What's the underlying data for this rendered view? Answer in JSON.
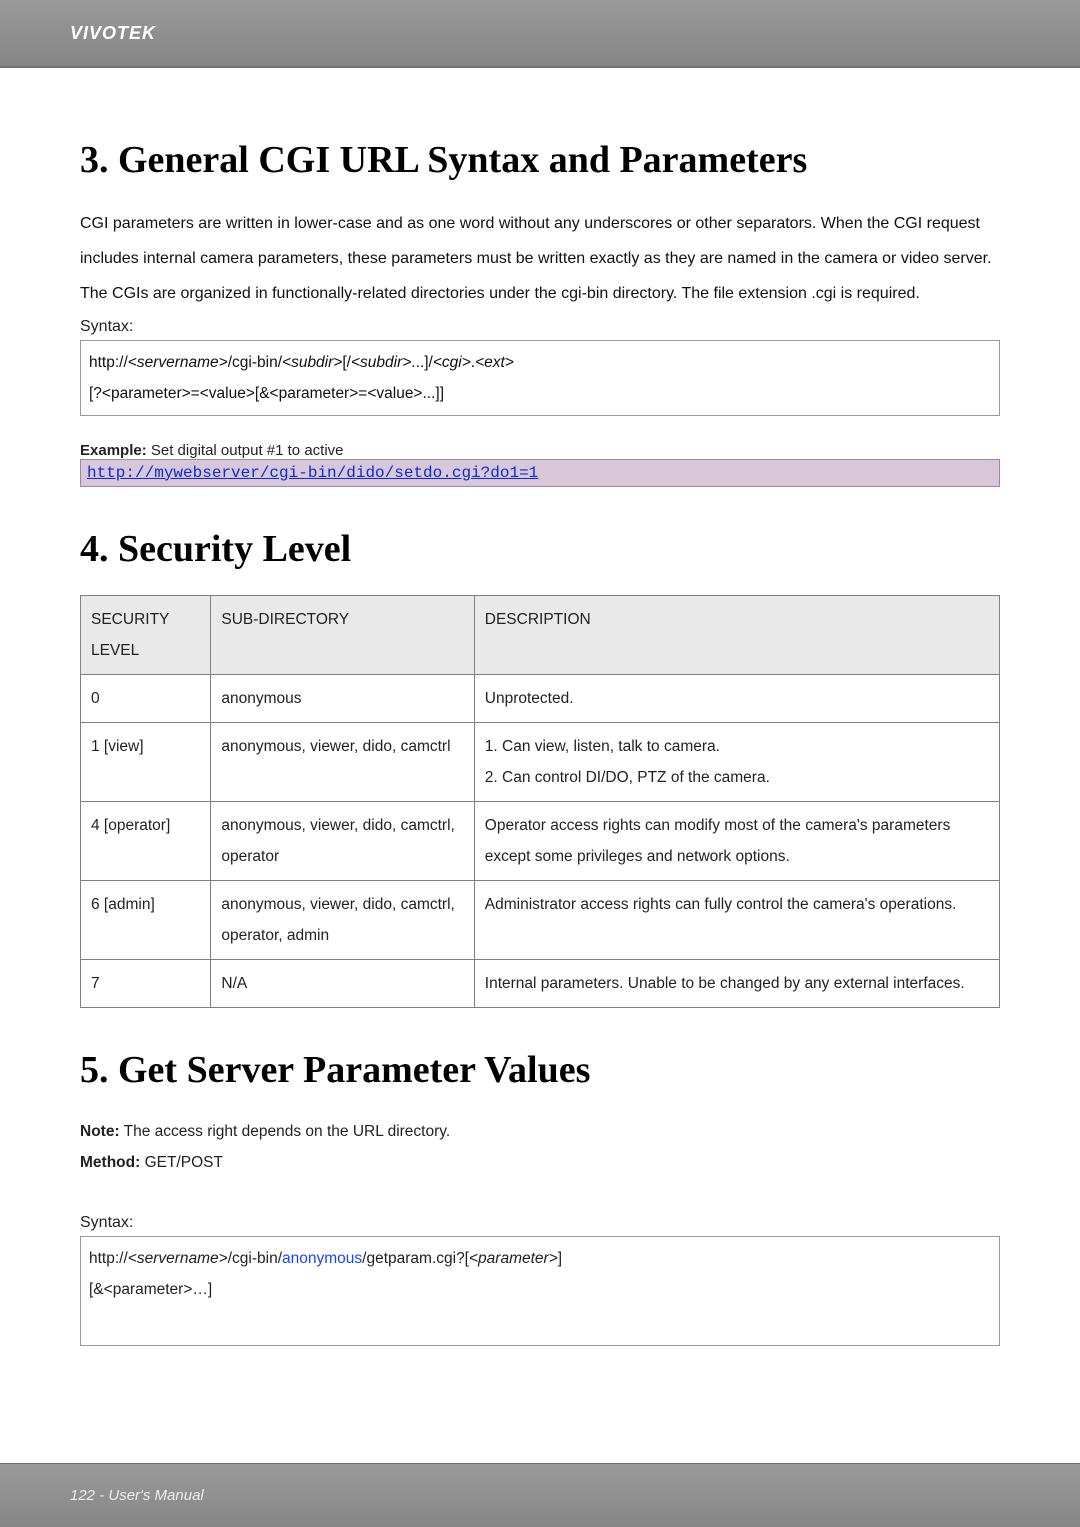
{
  "header": {
    "brand": "VIVOTEK"
  },
  "sections": {
    "s3": {
      "title": "3. General CGI URL Syntax and Parameters",
      "para": "CGI parameters are written in lower-case and as one word without any underscores or other separators. When the CGI request includes internal camera parameters, these parameters must be written exactly as they are named in the camera or video server. The CGIs are organized in functionally-related directories under the cgi-bin directory. The file extension .cgi is required.",
      "syntax_label": "Syntax:",
      "syntax_line1_prefix": "http://",
      "syntax_line1_server": "<servername>",
      "syntax_line1_mid": "/cgi-bin/",
      "syntax_line1_subdir": "<subdir>",
      "syntax_line1_open": "[/",
      "syntax_line1_subdir2": "<subdir>",
      "syntax_line1_after": "...]/",
      "syntax_line1_cgi": "<cgi>",
      "syntax_line1_dot": ".",
      "syntax_line1_ext": "<ext>",
      "syntax_line2": "[?<parameter>=<value>[&<parameter>=<value>...]]",
      "example_label_bold": "Example:",
      "example_label_rest": " Set digital output #1 to active",
      "example_url": "http://mywebserver/cgi-bin/dido/setdo.cgi?do1=1"
    },
    "s4": {
      "title": "4. Security Level",
      "headers": {
        "c1": "SECURITY LEVEL",
        "c2": "SUB-DIRECTORY",
        "c3": "DESCRIPTION"
      },
      "rows": [
        {
          "level": "0",
          "subdir": "anonymous",
          "desc": "Unprotected."
        },
        {
          "level": "1 [view]",
          "subdir": "anonymous, viewer, dido, camctrl",
          "desc": "1. Can view, listen, talk to camera.\n2. Can control DI/DO, PTZ of the camera."
        },
        {
          "level": "4 [operator]",
          "subdir": "anonymous, viewer, dido, camctrl, operator",
          "desc": "Operator access rights can modify most of the camera's parameters except some privileges and network options."
        },
        {
          "level": "6 [admin]",
          "subdir": "anonymous, viewer, dido, camctrl, operator, admin",
          "desc": "Administrator access rights can fully control the camera's operations."
        },
        {
          "level": "7",
          "subdir": "N/A",
          "desc": "Internal parameters. Unable to be changed by any external interfaces."
        }
      ]
    },
    "s5": {
      "title": "5. Get Server Parameter Values",
      "note_bold": "Note:",
      "note_rest": " The access right depends on the URL directory.",
      "method_bold": "Method:",
      "method_rest": " GET/POST",
      "syntax_label": "Syntax:",
      "line1_prefix": "http://",
      "line1_server": "<servername>",
      "line1_mid1": "/cgi-bin/",
      "line1_anon": "anonymous",
      "line1_mid2": "/getparam.cgi?[",
      "line1_param": "<parameter>",
      "line1_close": "]",
      "line2": "[&<parameter>…]"
    }
  },
  "footer": {
    "text": "122 - User's Manual"
  }
}
